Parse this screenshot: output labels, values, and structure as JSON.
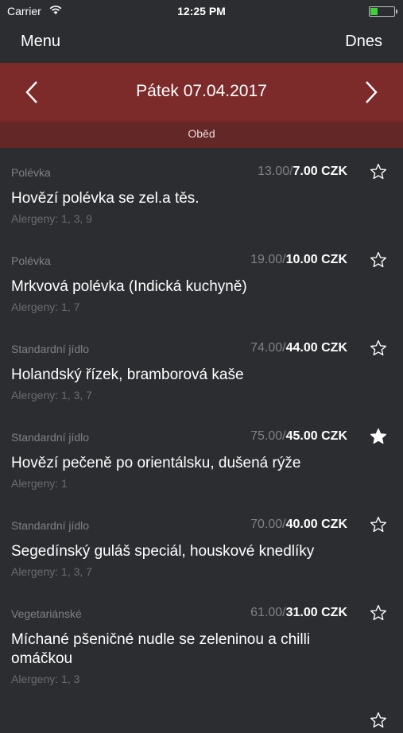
{
  "status_bar": {
    "carrier": "Carrier",
    "time": "12:25 PM",
    "battery_level": 0.3
  },
  "nav": {
    "left": "Menu",
    "right": "Dnes"
  },
  "date_bar": {
    "date": "Pátek 07.04.2017"
  },
  "meal": "Oběd",
  "colors": {
    "background": "#2b2d30",
    "date_bar": "#7d2a2b",
    "meal_bar": "#622726",
    "battery": "#3fd13c"
  },
  "items": [
    {
      "category": "Polévka",
      "old_price": "13.00/",
      "price": "7.00 CZK",
      "name": "Hovězí polévka se zel.a těs.",
      "allergens": "Alergeny: 1, 3, 9",
      "favorite": false
    },
    {
      "category": "Polévka",
      "old_price": "19.00/",
      "price": "10.00 CZK",
      "name": "Mrkvová polévka (Indická kuchyně)",
      "allergens": "Alergeny: 1, 7",
      "favorite": false
    },
    {
      "category": "Standardní jídlo",
      "old_price": "74.00/",
      "price": "44.00 CZK",
      "name": "Holandský řízek, bramborová kaše",
      "allergens": "Alergeny: 1, 3, 7",
      "favorite": false
    },
    {
      "category": "Standardní jídlo",
      "old_price": "75.00/",
      "price": "45.00 CZK",
      "name": "Hovězí pečeně po orientálsku, dušená rýže",
      "allergens": "Alergeny: 1",
      "favorite": true
    },
    {
      "category": "Standardní jídlo",
      "old_price": "70.00/",
      "price": "40.00 CZK",
      "name": "Segedínský guláš speciál, houskové knedlíky",
      "allergens": "Alergeny: 1, 3, 7",
      "favorite": false
    },
    {
      "category": "Vegetariánské",
      "old_price": "61.00/",
      "price": "31.00 CZK",
      "name": "Míchané pšeničné nudle se zeleninou a chilli omáčkou",
      "allergens": "Alergeny: 1, 3",
      "favorite": false
    }
  ]
}
